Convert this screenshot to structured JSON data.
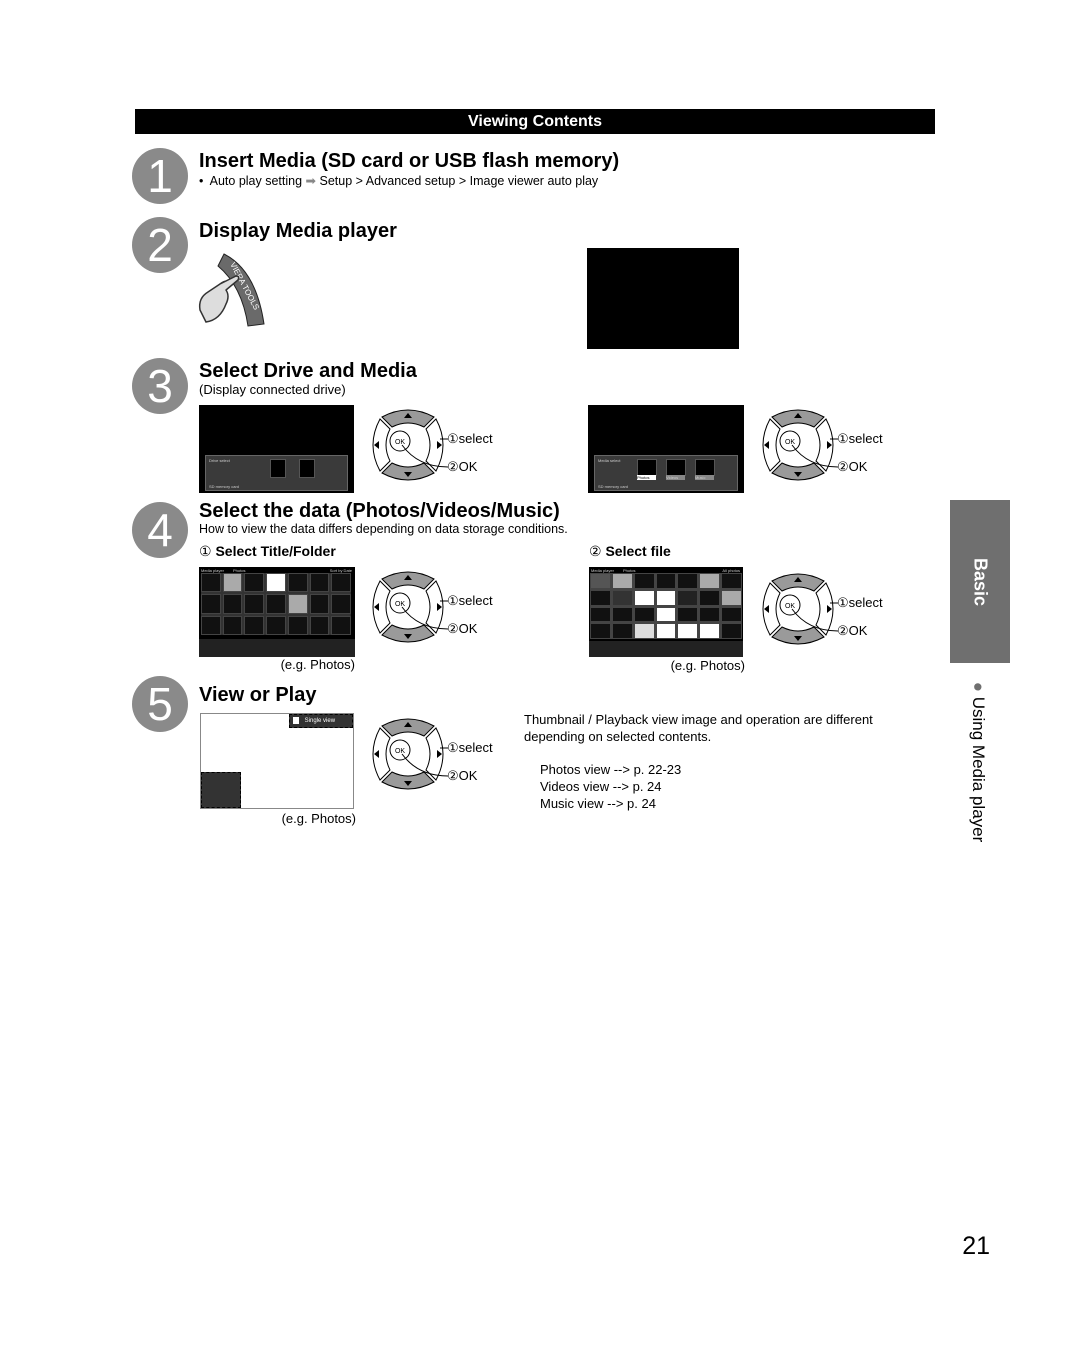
{
  "header": {
    "title": "Viewing Contents"
  },
  "steps": [
    {
      "num": "1",
      "title": "Insert Media (SD card or USB flash memory)",
      "note": "Auto play setting",
      "note_path": "Setup > Advanced setup > Image viewer auto play"
    },
    {
      "num": "2",
      "title": "Display Media player",
      "button_label": "VIERA TOOLS"
    },
    {
      "num": "3",
      "title": "Select Drive and Media",
      "subtitle": "(Display connected drive)",
      "screen1": {
        "heading": "Drive select",
        "footer": "SD memory card"
      },
      "screen2": {
        "heading": "Media select",
        "footer": "SD memory card",
        "tabs": [
          "Photos",
          "Videos",
          "Music"
        ]
      }
    },
    {
      "num": "4",
      "title": "Select the data (Photos/Videos/Music)",
      "subtitle": "How to view the data differs depending on data storage conditions.",
      "sub1": {
        "mark": "①",
        "label": "Select Title/Folder",
        "screen_header": [
          "Media player",
          "Photos",
          "Sort by Date"
        ],
        "caption": "(e.g. Photos)"
      },
      "sub2": {
        "mark": "②",
        "label": "Select file",
        "screen_header": [
          "Media player",
          "Photos",
          "All photos"
        ],
        "caption": "(e.g. Photos)"
      }
    },
    {
      "num": "5",
      "title": "View or Play",
      "screen_badge": "Single view",
      "caption": "(e.g. Photos)",
      "description": [
        "Thumbnail / Playback view image and operation are different",
        "depending on selected contents."
      ],
      "links": [
        "Photos view --> p. 22-23",
        "Videos view --> p. 24",
        "Music view --> p. 24"
      ]
    }
  ],
  "remote": {
    "ok": "OK",
    "select": "①select",
    "confirm": "②OK"
  },
  "side_tab": {
    "section": "Basic",
    "bullet": "●",
    "topic": "Using Media player"
  },
  "page_number": "21",
  "colors": {
    "header_bg": "#000000",
    "step_circle": "#8a8a8a",
    "side_tab": "#6f6f6f"
  }
}
